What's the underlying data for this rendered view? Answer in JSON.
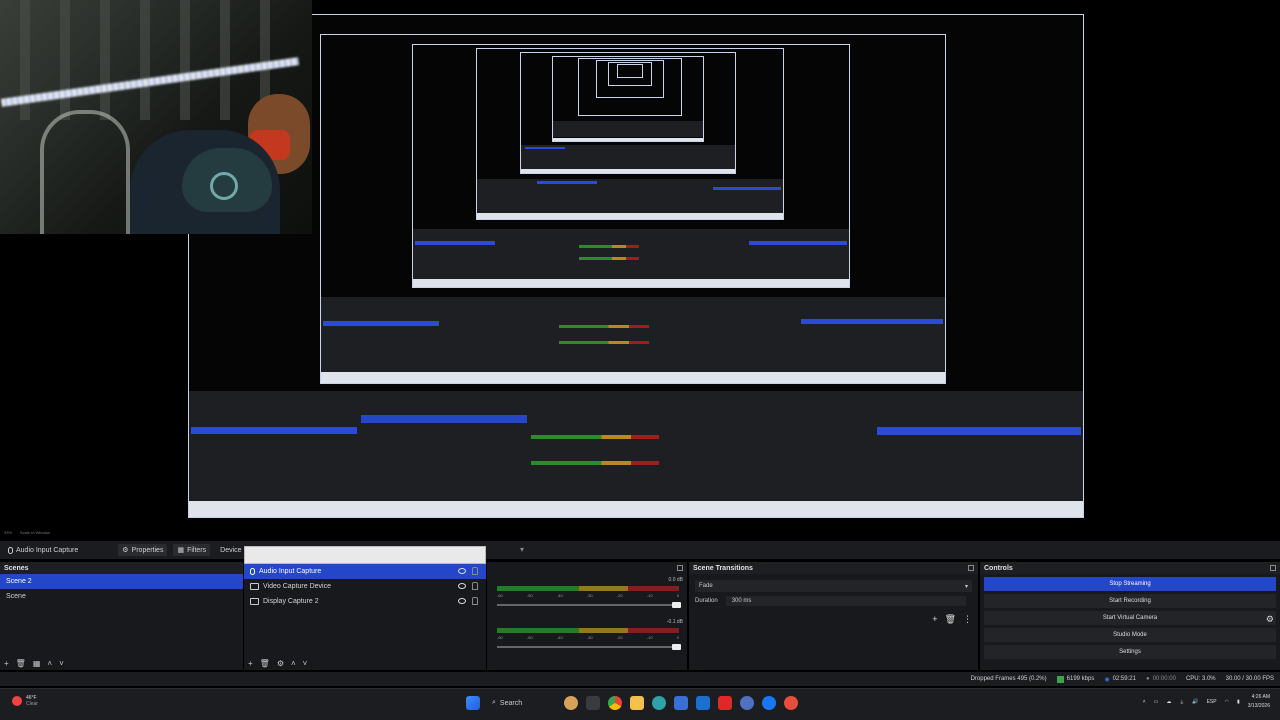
{
  "toolbar": {
    "source_name": "Audio Input Capture",
    "properties": "Properties",
    "filters": "Filters",
    "device": "Device",
    "truncated": "M"
  },
  "scenes": {
    "title": "Scenes",
    "items": [
      {
        "label": "Scene 2",
        "active": true
      },
      {
        "label": "Scene",
        "active": false
      }
    ]
  },
  "sources": {
    "items": [
      {
        "label": "Audio Input Capture",
        "active": true
      },
      {
        "label": "Video Capture Device",
        "active": false
      },
      {
        "label": "Display Capture 2",
        "active": false
      }
    ]
  },
  "mixer": {
    "tracks": [
      {
        "db": "0.0 dB",
        "scale": [
          "-60",
          "-50",
          "-40",
          "-30",
          "-20",
          "-10",
          "0"
        ]
      },
      {
        "db": "-0.1 dB",
        "scale": [
          "-60",
          "-50",
          "-40",
          "-30",
          "-20",
          "-10",
          "0"
        ]
      }
    ]
  },
  "transitions": {
    "title": "Scene Transitions",
    "type": "Fade",
    "duration_label": "Duration",
    "duration_value": "300 ms"
  },
  "controls": {
    "title": "Controls",
    "buttons": {
      "stop_streaming": "Stop Streaming",
      "start_recording": "Start Recording",
      "start_virtual_camera": "Start Virtual Camera",
      "studio_mode": "Studio Mode",
      "settings": "Settings"
    }
  },
  "status": {
    "dropped_frames": "Dropped Frames 495 (0.2%)",
    "bitrate": "6199 kbps",
    "stream_time": "02:59:21",
    "record_time": "00:00:00",
    "cpu": "CPU: 3.0%",
    "fps": "30.00 / 30.00 FPS"
  },
  "taskbar": {
    "weather_temp": "46°F",
    "weather_desc": "Clear",
    "search": "Search",
    "time": "4:26 AM",
    "date": "3/13/2026",
    "lang": "ESP"
  },
  "preview_toolbar": {
    "zoom": "93%",
    "scale": "Scale to Window"
  },
  "colors": {
    "accent": "#2446c8",
    "background": "#18191c"
  }
}
